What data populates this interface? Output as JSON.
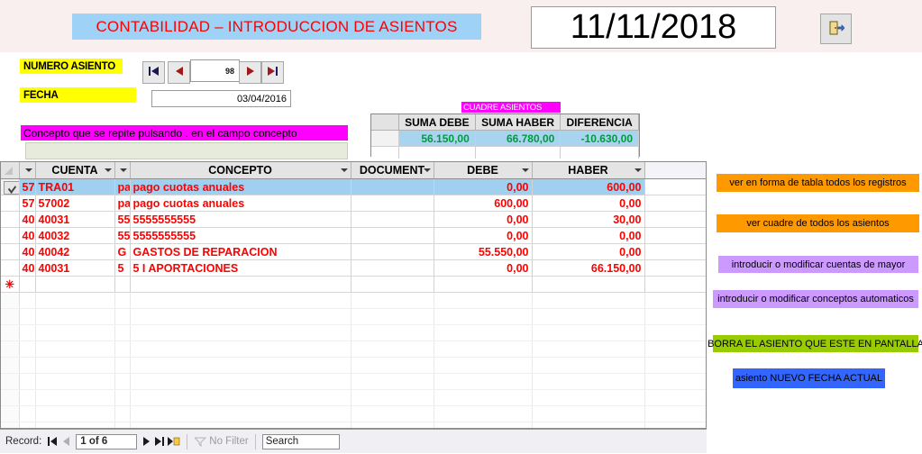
{
  "header": {
    "title": "CONTABILIDAD – INTRODUCCION DE ASIENTOS",
    "current_date": "11/11/2018",
    "exit_icon": "exit-door-icon"
  },
  "form": {
    "numero_asiento_label": "NUMERO ASIENTO",
    "numero_asiento_value": "98",
    "fecha_label": "FECHA",
    "fecha_value": "03/04/2016",
    "nav": {
      "first": "first-record-icon",
      "prev": "previous-record-icon",
      "next": "next-record-icon",
      "last": "last-record-icon"
    },
    "concepto_repeat_label": "Concepto que se repite pulsando  .  en el campo concepto",
    "concepto_repeat_value": ""
  },
  "cuadre": {
    "title": "CUADRE ASIENTOS",
    "headers": [
      "SUMA DEBE",
      "SUMA HABER",
      "DIFERENCIA"
    ],
    "values": [
      "56.150,00",
      "66.780,00",
      "-10.630,00"
    ]
  },
  "grid": {
    "headers": [
      "",
      "",
      "CUENTA",
      "",
      "CONCEPTO",
      "DOCUMENT",
      "DEBE",
      "HABER"
    ],
    "rows": [
      {
        "hidden1": "57",
        "cuenta": "TRA01",
        "hidden2": "pa",
        "concepto": "pago cuotas anuales",
        "document": "",
        "debe": "0,00",
        "haber": "600,00",
        "selected": true
      },
      {
        "hidden1": "57",
        "cuenta": "57002",
        "hidden2": "pa",
        "concepto": "pago cuotas anuales",
        "document": "",
        "debe": "600,00",
        "haber": "0,00",
        "selected": false
      },
      {
        "hidden1": "40",
        "cuenta": "40031",
        "hidden2": "55",
        "concepto": "5555555555",
        "document": "",
        "debe": "0,00",
        "haber": "30,00",
        "selected": false
      },
      {
        "hidden1": "40",
        "cuenta": "40032",
        "hidden2": "55",
        "concepto": "5555555555",
        "document": "",
        "debe": "0,00",
        "haber": "0,00",
        "selected": false
      },
      {
        "hidden1": "40",
        "cuenta": "40042",
        "hidden2": "G",
        "concepto": "GASTOS DE REPARACION",
        "document": "",
        "debe": "55.550,00",
        "haber": "0,00",
        "selected": false
      },
      {
        "hidden1": "40",
        "cuenta": "40031",
        "hidden2": "5",
        "concepto": "5 I APORTACIONES",
        "document": "",
        "debe": "0,00",
        "haber": "66.150,00",
        "selected": false
      }
    ],
    "new_record_marker": "✳"
  },
  "recordbar": {
    "label": "Record:",
    "position": "1 of 6",
    "filter_text": "No Filter",
    "search_text": "Search",
    "icons": {
      "first": "first-record-icon",
      "prev": "previous-record-icon",
      "next": "next-record-icon",
      "last": "last-record-icon",
      "new": "new-record-icon",
      "filter": "filter-icon"
    }
  },
  "actions": [
    {
      "id": "btn-tabla",
      "label": "ver en forma de tabla todos los registros",
      "color": "#ff9900"
    },
    {
      "id": "btn-cuadre",
      "label": "ver cuadre de todos los asientos",
      "color": "#ff9900"
    },
    {
      "id": "btn-cuentas",
      "label": "introducir o modificar cuentas de mayor",
      "color": "#cc99ff"
    },
    {
      "id": "btn-conceptos",
      "label": "introducir o modificar conceptos automaticos",
      "color": "#cc99ff"
    },
    {
      "id": "btn-borra",
      "label": "BORRA EL ASIENTO QUE ESTE EN PANTALLA",
      "color": "#99cc00"
    },
    {
      "id": "btn-nuevo",
      "label": "asiento NUEVO FECHA ACTUAL",
      "color": "#3366ff"
    }
  ],
  "colors": {
    "title_bg": "#9fd2f7",
    "title_fg": "#ff0000",
    "label_yellow": "#ffff00",
    "label_magenta": "#ff00ff",
    "row_selected": "#9fd0ef",
    "data_text": "#ff0000",
    "cuadre_value": "#009a3d"
  }
}
